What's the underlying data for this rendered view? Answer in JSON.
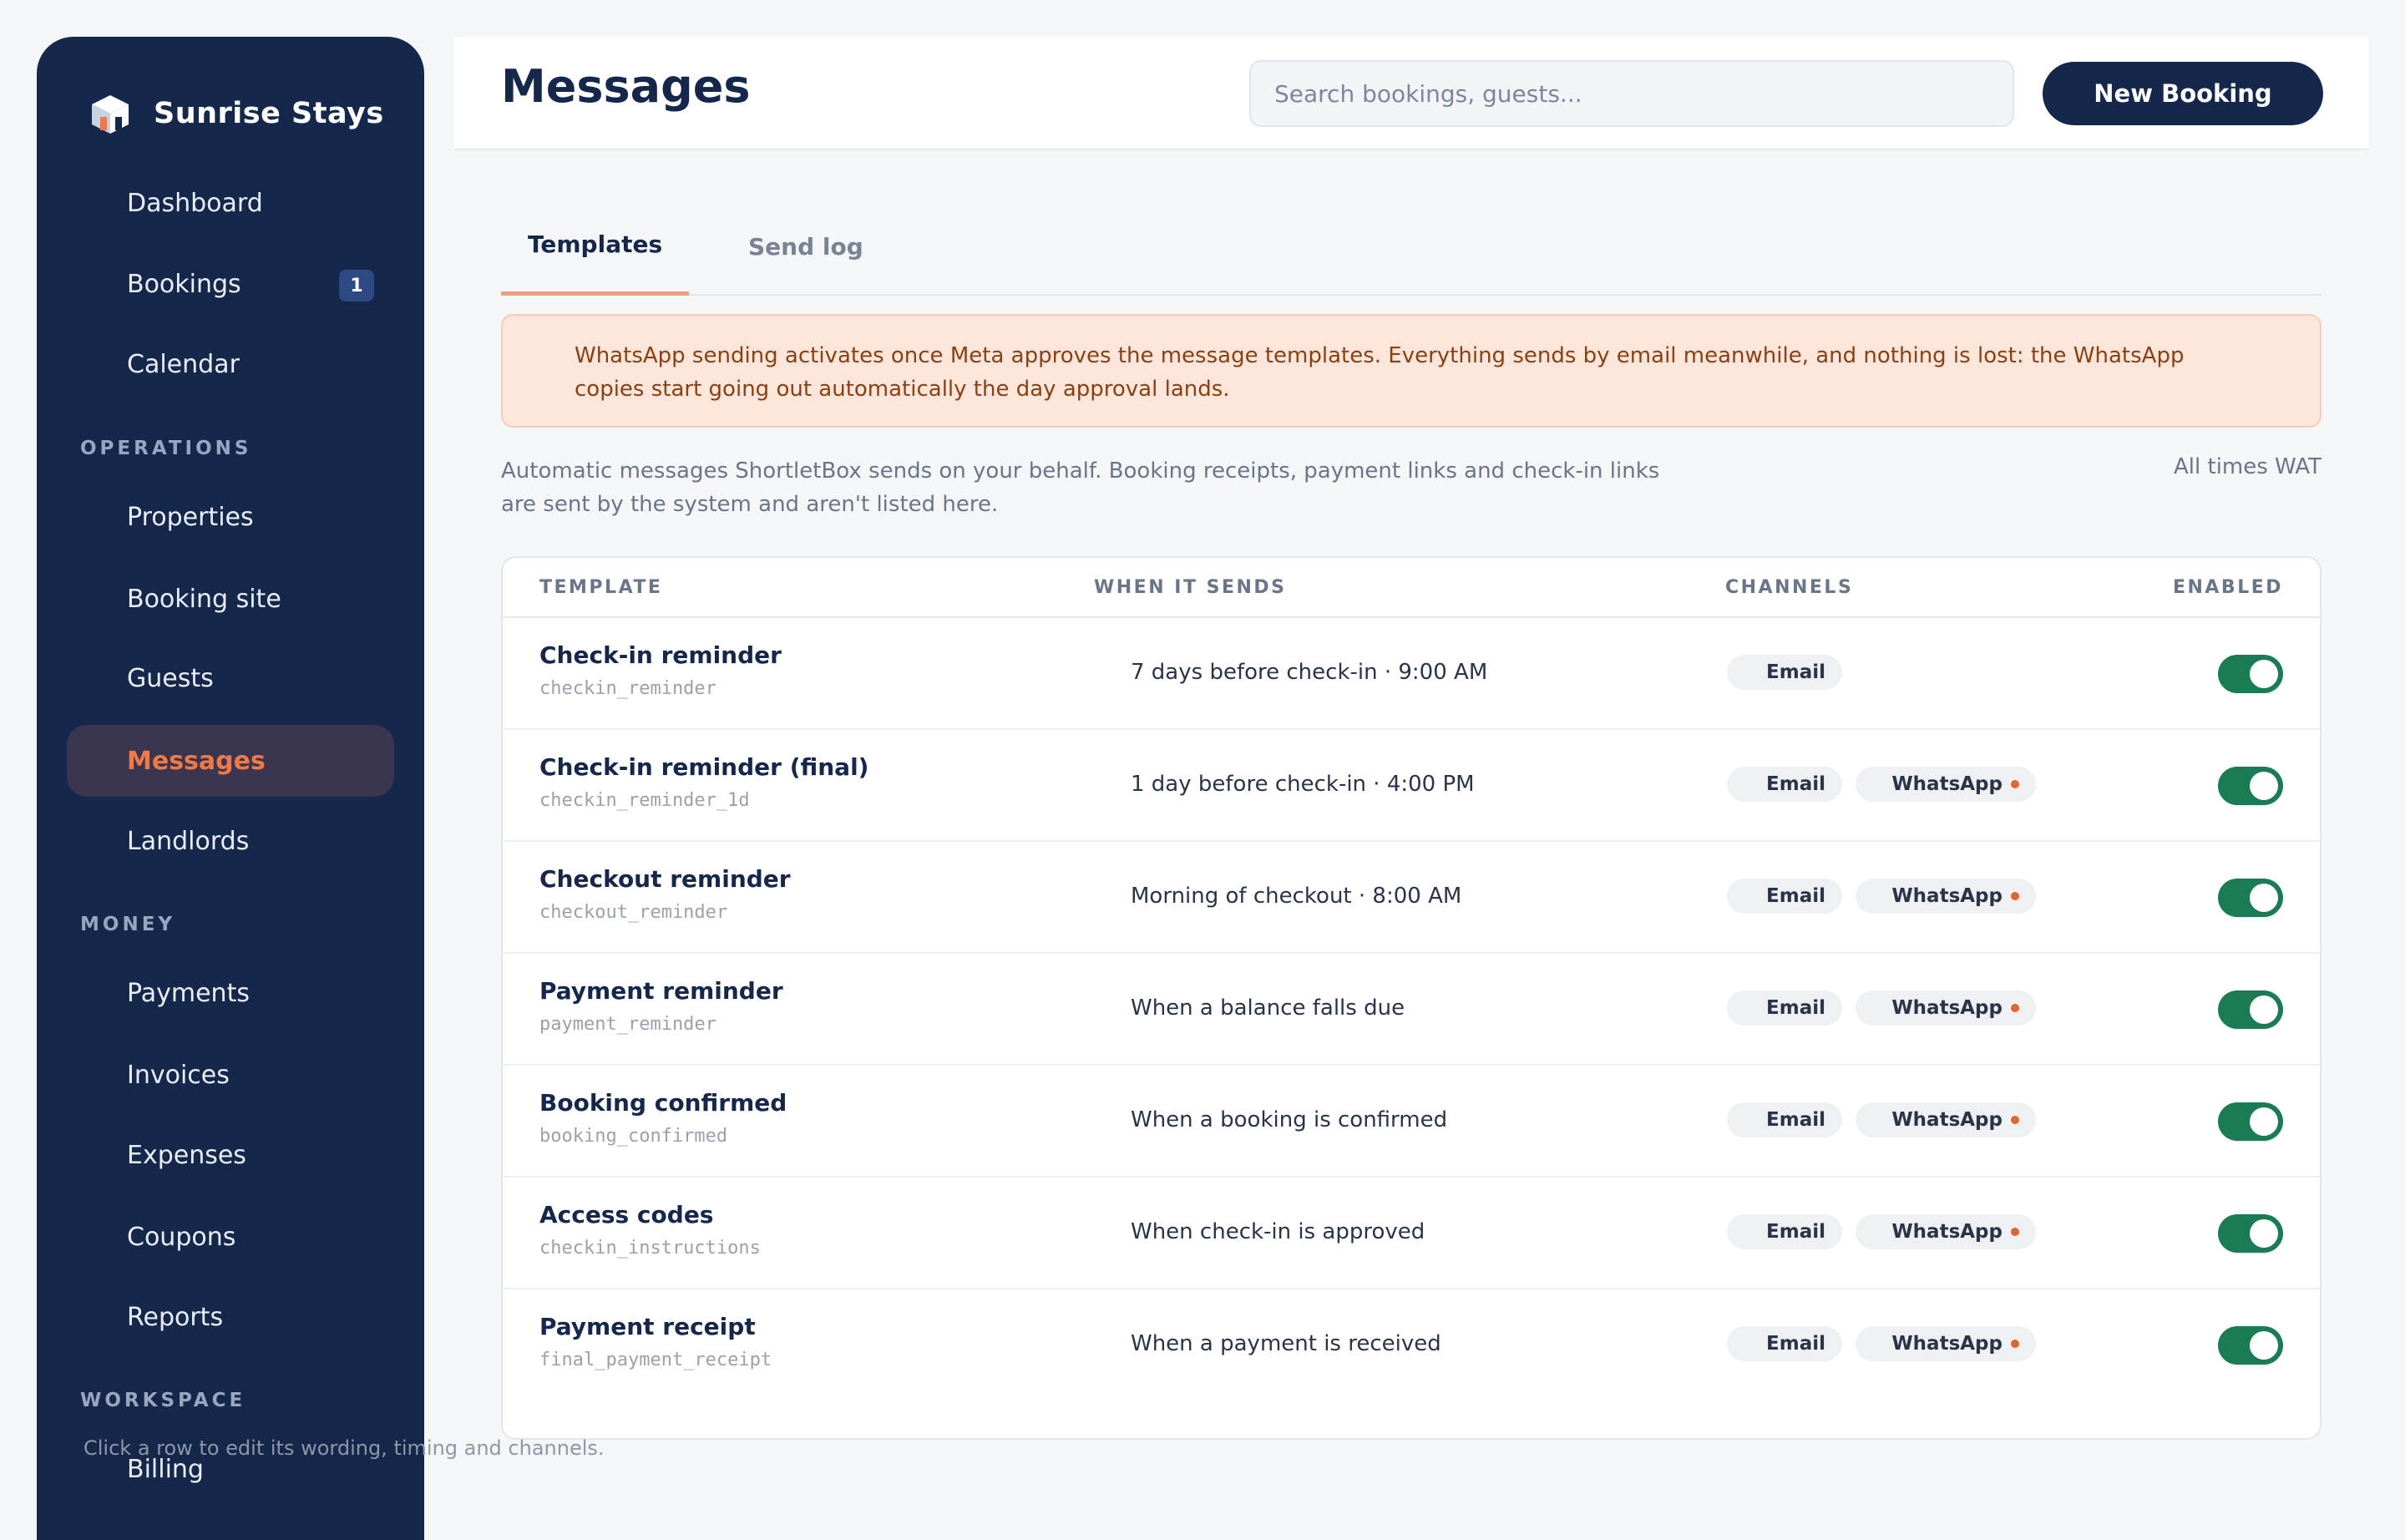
{
  "brand": {
    "name": "Sunrise Stays"
  },
  "sidebar": {
    "items": [
      {
        "label": "Dashboard"
      },
      {
        "label": "Bookings",
        "badge": "1"
      },
      {
        "label": "Calendar"
      },
      {
        "label": "Properties"
      },
      {
        "label": "Booking site"
      },
      {
        "label": "Guests"
      },
      {
        "label": "Messages"
      },
      {
        "label": "Landlords"
      },
      {
        "label": "Payments"
      },
      {
        "label": "Invoices"
      },
      {
        "label": "Expenses"
      },
      {
        "label": "Coupons"
      },
      {
        "label": "Reports"
      },
      {
        "label": "Billing"
      }
    ],
    "sections": [
      "OPERATIONS",
      "MONEY",
      "WORKSPACE"
    ]
  },
  "header": {
    "title": "Messages",
    "search_placeholder": "Search bookings, guests...",
    "new_booking_label": "New Booking"
  },
  "tabs": [
    {
      "label": "Templates"
    },
    {
      "label": "Send log"
    }
  ],
  "banner": {
    "text": "WhatsApp sending activates once Meta approves the message templates. Everything sends by email meanwhile, and nothing is lost: the WhatsApp copies start going out automatically the day approval lands."
  },
  "intro": {
    "text": "Automatic messages ShortletBox sends on your behalf. Booking receipts, payment links and check-in links are sent by the system and aren't listed here.",
    "timezone": "All times WAT"
  },
  "table": {
    "headers": {
      "template": "TEMPLATE",
      "when": "WHEN IT SENDS",
      "channels": "CHANNELS",
      "enabled": "ENABLED"
    },
    "rows": [
      {
        "name": "Check-in reminder",
        "key": "checkin_reminder",
        "when": "7 days before check-in · 9:00 AM",
        "email": "Email",
        "whatsapp": "",
        "enabled": true
      },
      {
        "name": "Check-in reminder (final)",
        "key": "checkin_reminder_1d",
        "when": "1 day before check-in · 4:00 PM",
        "email": "Email",
        "whatsapp": "WhatsApp",
        "enabled": true
      },
      {
        "name": "Checkout reminder",
        "key": "checkout_reminder",
        "when": "Morning of checkout · 8:00 AM",
        "email": "Email",
        "whatsapp": "WhatsApp",
        "enabled": true
      },
      {
        "name": "Payment reminder",
        "key": "payment_reminder",
        "when": "When a balance falls due",
        "email": "Email",
        "whatsapp": "WhatsApp",
        "enabled": true
      },
      {
        "name": "Booking confirmed",
        "key": "booking_confirmed",
        "when": "When a booking is confirmed",
        "email": "Email",
        "whatsapp": "WhatsApp",
        "enabled": true
      },
      {
        "name": "Access codes",
        "key": "checkin_instructions",
        "when": "When check-in is approved",
        "email": "Email",
        "whatsapp": "WhatsApp",
        "enabled": true
      },
      {
        "name": "Payment receipt",
        "key": "final_payment_receipt",
        "when": "When a payment is received",
        "email": "Email",
        "whatsapp": "WhatsApp",
        "enabled": true
      }
    ]
  },
  "footnote": "Click a row to edit its wording, timing and channels.",
  "colors": {
    "sidebar": "#15284b",
    "accent": "#f07a45",
    "toggle_on": "#1b7b52",
    "banner_bg": "#fce6dc",
    "whatsapp_dot": "#e8602c"
  }
}
